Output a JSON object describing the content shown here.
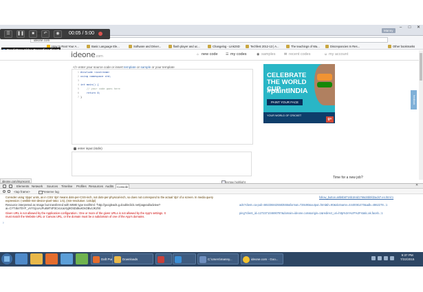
{
  "browser": {
    "user_badge": "Manny",
    "window_controls": [
      "–",
      "□",
      "✕"
    ],
    "tabs": [
      {
        "label": "ideone.com",
        "active": false
      }
    ],
    "address": "ideone.com",
    "bookmarks": [
      "How to Root Your A...",
      "Basic Language Ele...",
      "Software and Driver...",
      "flash player and uc...",
      "Changelog - Link2SD",
      "Techfest 2012-13 | A...",
      "The teachings of Wa...",
      "Discrepancies In Res...",
      "Other bookmarks"
    ]
  },
  "recorder": {
    "time": "00:05 / 5:00",
    "link": "Need More Video Recording Time?"
  },
  "site": {
    "logo": "ideone",
    "logo_suffix": ".com",
    "nav": {
      "new_code": "new code",
      "my_codes": "my codes",
      "samples": "samples",
      "recent_codes": "recent codes",
      "my_account": "my account"
    }
  },
  "editor": {
    "instruction_prefix": "</> enter your source code or insert",
    "instruction_template": "template",
    "instruction_or": "or",
    "instruction_sample": "sample",
    "instruction_suffix": "or your template",
    "lines": [
      {
        "n": "1",
        "code": "#include <iostream>"
      },
      {
        "n": "2",
        "code": "using namespace std;"
      },
      {
        "n": "3",
        "code": ""
      },
      {
        "n": "4",
        "code": "int main() {"
      },
      {
        "n": "5",
        "code": "    // your code goes here"
      },
      {
        "n": "6",
        "code": "    return 0;"
      },
      {
        "n": "7",
        "code": "}"
      }
    ],
    "stdin_label": "enter input (stdin)",
    "syntax_label": "syntax highlight"
  },
  "ad": {
    "line1": "CELEBRATE THE WORLD CUP",
    "line2": "#paintINDIA",
    "button": "PAINT YOUR FACE",
    "footer": "YOUR WORLD OF CRICKET",
    "gplus": "g+"
  },
  "sidebar": {
    "feedback": "feedback",
    "new_job": "Time for a new job?"
  },
  "status_url": "ideone.com/myrecent",
  "devtools": {
    "tabs": [
      "Elements",
      "Network",
      "Sources",
      "Timeline",
      "Profiles",
      "Resources",
      "Audits",
      "Console"
    ],
    "context": "<top frame>",
    "preserve_log": "Preserve log",
    "messages": [
      {
        "type": "warn",
        "text": "Consider using 'dppx' units, as in CSS 'dpi' means dots-per-CSS-inch, not dots-per-physical-inch, so does not correspond to the actual 'dpi' of a screen. In media query",
        "src": "follow_button.a8b6b8716b184d1766d4bbfd2ad47.en.html:1"
      },
      {
        "type": "warn",
        "text": "expression: (-webkit-min-device-pixel-ratio: 1.5), (min-resolution: 144dpi)",
        "src": ""
      },
      {
        "type": "log",
        "text": "Resource interpreted as Image but transferred with MIME type text/html: \"http://googleads.g.doubleclick.net/pagead/adview?",
        "src": "ads?client=ca-pub-4653368425583555&format=728x90&output=html&h=90&slotname=4440081470&adk=4862278..:1"
      },
      {
        "type": "log",
        "text": "ai=CYT4knTbYF_vVYSjcxAcPu6MT4P3CvUcaiXyj9G5Dd6uK0sOBvzJK2h0",
        "src": ""
      },
      {
        "type": "err",
        "text": "Given URL is not allowed by the Application configuration.: One or more of the given URLs is not allowed by the App's settings.  It",
        "src": "ping?client_id=127237104690787&domain=ideone.com&origin=1&redirect_uri=http%3A%2F%2Fstatic.ak.faceb..:1"
      },
      {
        "type": "err",
        "text": "must match the Website URL or Canvas URL, or the domain must be a subdomain of one of the App's domains.",
        "src": ""
      }
    ]
  },
  "taskbar": {
    "apps": [
      {
        "label": "Daft Punk - Get...",
        "color": "#e46d2e"
      },
      {
        "label": "Downloads",
        "color": "#e8b84a"
      },
      {
        "label": "",
        "color": "#c8413b"
      },
      {
        "label": "C:\\Users\\manny...",
        "color": "#6f8fbf"
      },
      {
        "label": "",
        "color": "#3c8fd6"
      },
      {
        "label": "ideone.com - Goo...",
        "color": "#f2c230"
      }
    ],
    "time": "9:37 PM",
    "date": "7/22/2015"
  }
}
